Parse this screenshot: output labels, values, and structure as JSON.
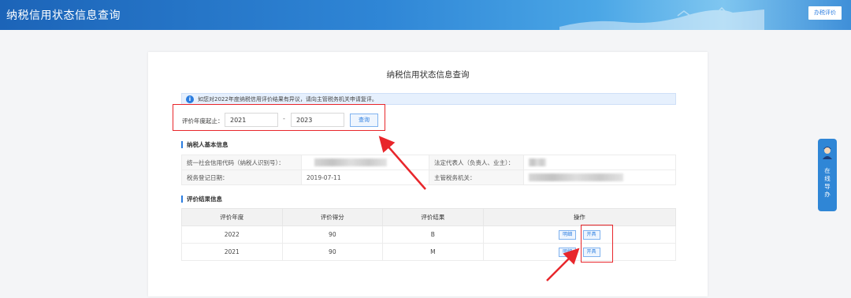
{
  "header": {
    "title": "纳税信用状态信息查询",
    "button_label": "办税评价"
  },
  "page": {
    "title": "纳税信用状态信息查询"
  },
  "notice": {
    "icon": "info-icon",
    "text": "如您对2022年度纳税信用评价结果有异议，请向主管税务机关申请复评。"
  },
  "filter": {
    "label": "评价年度起止：",
    "from_year": "2021",
    "separator": "-",
    "to_year": "2023",
    "query_label": "查询"
  },
  "basic_info": {
    "section_title": "纳税人基本信息",
    "credit_code_label": "统一社会信用代码（纳税人识别号）：",
    "legal_rep_label": "法定代表人（负责人、业主）：",
    "reg_date_label": "税务登记日期：",
    "reg_date_value": "2019-07-11",
    "tax_office_label": "主管税务机关："
  },
  "results": {
    "section_title": "评价结果信息",
    "columns": [
      "评价年度",
      "评价得分",
      "评价结果",
      "操作"
    ],
    "rows": [
      {
        "year": "2022",
        "score": "90",
        "grade": "B",
        "detail_label": "明细",
        "print_label": "开具"
      },
      {
        "year": "2021",
        "score": "90",
        "grade": "M",
        "detail_label": "明细",
        "print_label": "开具"
      }
    ]
  },
  "side_widget": {
    "text": "在线导办",
    "icon": "service-avatar-icon"
  },
  "colors": {
    "accent": "#2b7de0",
    "highlight": "#e8262b",
    "header_bg": "#2f86d6"
  }
}
